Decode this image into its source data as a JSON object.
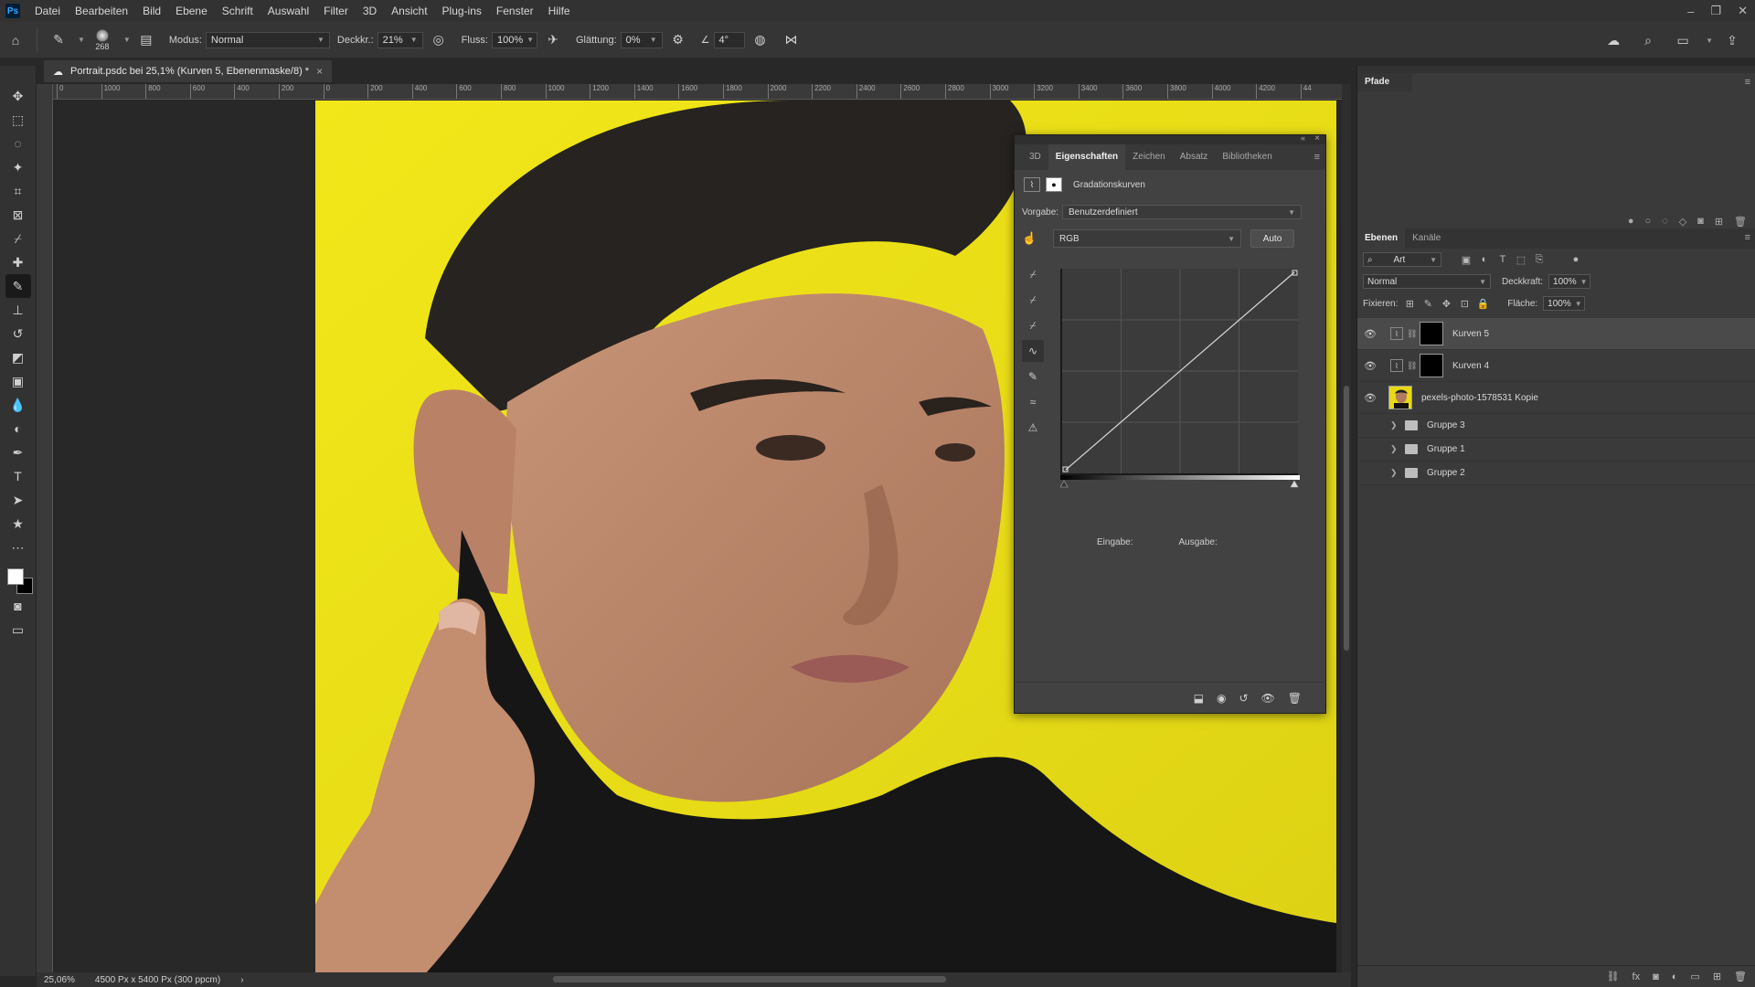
{
  "app": {
    "logo": "Ps"
  },
  "menu": [
    "Datei",
    "Bearbeiten",
    "Bild",
    "Ebene",
    "Schrift",
    "Auswahl",
    "Filter",
    "3D",
    "Ansicht",
    "Plug-ins",
    "Fenster",
    "Hilfe"
  ],
  "window_controls": {
    "minimize": "–",
    "restore": "❐",
    "close": "✕"
  },
  "options": {
    "brush_size": "268",
    "mode_label": "Modus:",
    "mode_value": "Normal",
    "opacity_label": "Deckkr.:",
    "opacity_value": "21%",
    "flow_label": "Fluss:",
    "flow_value": "100%",
    "smoothing_label": "Glättung:",
    "smoothing_value": "0%",
    "angle_value": "4°"
  },
  "document": {
    "tab_title": "Portrait.psdc bei 25,1% (Kurven 5, Ebenenmaske/8) *",
    "zoom": "25,06%",
    "doc_info": "4500 Px x 5400 Px (300 ppcm)"
  },
  "ruler_h": [
    "0",
    "1000",
    "800",
    "600",
    "400",
    "200",
    "0",
    "200",
    "400",
    "600",
    "800",
    "1000",
    "1200",
    "1400",
    "1600",
    "1800",
    "2000",
    "2200",
    "2400",
    "2600",
    "2800",
    "3000",
    "3200",
    "3400",
    "3600",
    "3800",
    "4000",
    "4200",
    "44"
  ],
  "properties": {
    "tabs": [
      "3D",
      "Eigenschaften",
      "Zeichen",
      "Absatz",
      "Bibliotheken"
    ],
    "active_tab": "Eigenschaften",
    "title": "Gradationskurven",
    "preset_label": "Vorgabe:",
    "preset_value": "Benutzerdefiniert",
    "channel_value": "RGB",
    "auto_label": "Auto",
    "input_label": "Eingabe:",
    "output_label": "Ausgabe:"
  },
  "pfade": {
    "tab": "Pfade"
  },
  "layers": {
    "tabs": [
      "Ebenen",
      "Kanäle"
    ],
    "filter_value": "Art",
    "blend_mode": "Normal",
    "opacity_label": "Deckkraft:",
    "opacity_value": "100%",
    "lock_label": "Fixieren:",
    "fill_label": "Fläche:",
    "fill_value": "100%",
    "items": [
      {
        "name": "Kurven 5",
        "type": "adjustment",
        "visible": true,
        "selected": true
      },
      {
        "name": "Kurven 4",
        "type": "adjustment",
        "visible": true,
        "selected": false
      },
      {
        "name": "pexels-photo-1578531 Kopie",
        "type": "pixel",
        "visible": true,
        "selected": false
      },
      {
        "name": "Gruppe 3",
        "type": "group",
        "visible": false,
        "selected": false
      },
      {
        "name": "Gruppe 1",
        "type": "group",
        "visible": false,
        "selected": false
      },
      {
        "name": "Gruppe 2",
        "type": "group",
        "visible": false,
        "selected": false
      }
    ]
  },
  "colors": {
    "foreground": "#ffffff",
    "background": "#000000",
    "canvas_yellow": "#f0e518"
  }
}
